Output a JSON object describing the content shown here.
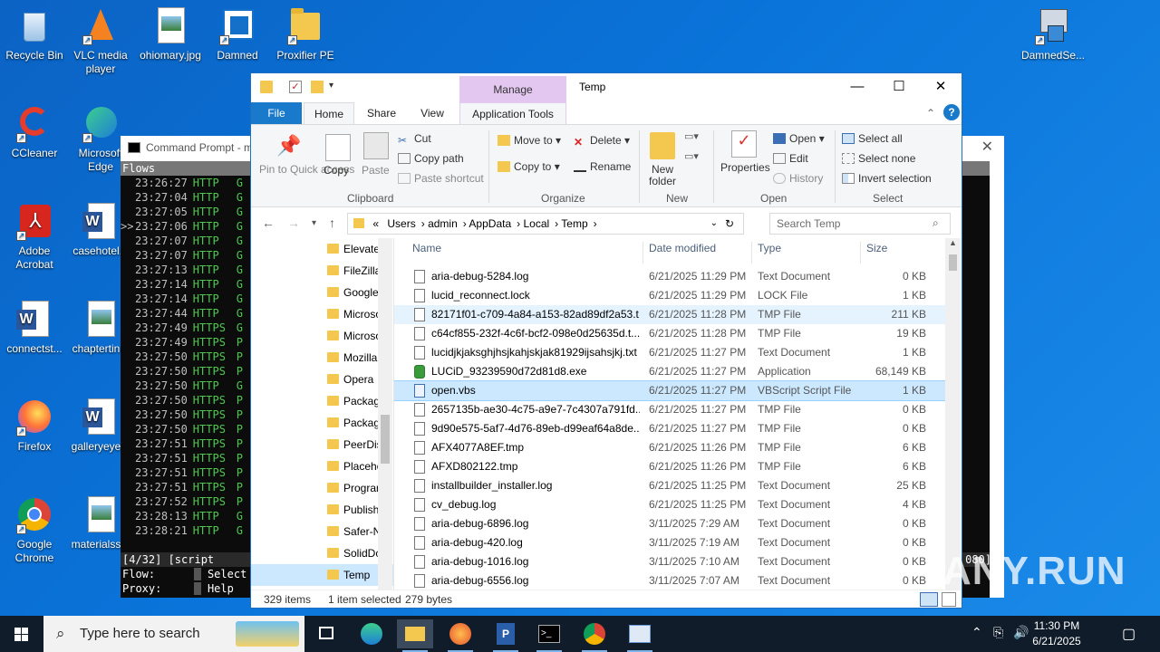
{
  "desktop": {
    "icons": [
      {
        "label": "Recycle Bin",
        "icon": "recycle-bin-icon"
      },
      {
        "label": "VLC media player",
        "icon": "vlc-icon"
      },
      {
        "label": "ohiomary.jpg",
        "icon": "image-file-icon"
      },
      {
        "label": "Damned",
        "icon": "damned-shortcut-icon"
      },
      {
        "label": "Proxifier PE",
        "icon": "folder-icon"
      },
      {
        "label": "CCleaner",
        "icon": "ccleaner-icon"
      },
      {
        "label": "Microsoft Edge",
        "icon": "edge-icon"
      },
      {
        "label": "Adobe Acrobat",
        "icon": "acrobat-icon"
      },
      {
        "label": "casehotel...",
        "icon": "word-doc-icon"
      },
      {
        "label": "connectst...",
        "icon": "word-doc-icon"
      },
      {
        "label": "chaptertin...",
        "icon": "image-file-icon"
      },
      {
        "label": "Firefox",
        "icon": "firefox-icon"
      },
      {
        "label": "galleryeye...",
        "icon": "word-doc-icon"
      },
      {
        "label": "Google Chrome",
        "icon": "chrome-icon"
      },
      {
        "label": "materialss...",
        "icon": "image-file-icon"
      },
      {
        "label": "DamnedSe...",
        "icon": "installer-icon"
      }
    ]
  },
  "cmd": {
    "title": "Command Prompt - m",
    "header": "Flows",
    "rows": [
      {
        "time": "23:26:27",
        "proto": "HTTP",
        "tail": "G"
      },
      {
        "time": "23:27:04",
        "proto": "HTTP",
        "tail": "G"
      },
      {
        "time": "23:27:05",
        "proto": "HTTP",
        "tail": "G"
      },
      {
        "time": "23:27:06",
        "proto": "HTTP",
        "tail": "G",
        "marker": ">>"
      },
      {
        "time": "23:27:07",
        "proto": "HTTP",
        "tail": "G"
      },
      {
        "time": "23:27:07",
        "proto": "HTTP",
        "tail": "G"
      },
      {
        "time": "23:27:13",
        "proto": "HTTP",
        "tail": "G"
      },
      {
        "time": "23:27:14",
        "proto": "HTTP",
        "tail": "G"
      },
      {
        "time": "23:27:14",
        "proto": "HTTP",
        "tail": "G"
      },
      {
        "time": "23:27:44",
        "proto": "HTTP",
        "tail": "G"
      },
      {
        "time": "23:27:49",
        "proto": "HTTPS",
        "tail": "G"
      },
      {
        "time": "23:27:49",
        "proto": "HTTPS",
        "tail": "P"
      },
      {
        "time": "23:27:50",
        "proto": "HTTPS",
        "tail": "P"
      },
      {
        "time": "23:27:50",
        "proto": "HTTPS",
        "tail": "P"
      },
      {
        "time": "23:27:50",
        "proto": "HTTP",
        "tail": "G"
      },
      {
        "time": "23:27:50",
        "proto": "HTTPS",
        "tail": "P"
      },
      {
        "time": "23:27:50",
        "proto": "HTTPS",
        "tail": "P"
      },
      {
        "time": "23:27:50",
        "proto": "HTTPS",
        "tail": "P"
      },
      {
        "time": "23:27:51",
        "proto": "HTTPS",
        "tail": "P"
      },
      {
        "time": "23:27:51",
        "proto": "HTTPS",
        "tail": "P"
      },
      {
        "time": "23:27:51",
        "proto": "HTTPS",
        "tail": "P"
      },
      {
        "time": "23:27:51",
        "proto": "HTTPS",
        "tail": "P"
      },
      {
        "time": "23:27:52",
        "proto": "HTTPS",
        "tail": "P"
      },
      {
        "time": "23:28:13",
        "proto": "HTTP",
        "tail": "G"
      },
      {
        "time": "23:28:21",
        "proto": "HTTP",
        "tail": "G"
      }
    ],
    "status_bar": "[4/32]  [script",
    "status_right": "080]",
    "footer": [
      {
        "key": "Flow:",
        "action": "Select"
      },
      {
        "key": "Proxy:",
        "action": "Help"
      }
    ]
  },
  "explorer": {
    "title": "Temp",
    "manage_tab": "Manage",
    "tabs": {
      "file": "File",
      "home": "Home",
      "share": "Share",
      "view": "View",
      "app_tools": "Application Tools"
    },
    "ribbon": {
      "pin": "Pin to Quick access",
      "copy": "Copy",
      "paste": "Paste",
      "cut": "Cut",
      "copy_path": "Copy path",
      "paste_shortcut": "Paste shortcut",
      "clipboard": "Clipboard",
      "move_to": "Move to",
      "copy_to": "Copy to",
      "delete": "Delete",
      "rename": "Rename",
      "organize": "Organize",
      "new_folder": "New folder",
      "new": "New",
      "properties": "Properties",
      "open_btn": "Open",
      "edit": "Edit",
      "history": "History",
      "open_group": "Open",
      "select_all": "Select all",
      "select_none": "Select none",
      "invert_selection": "Invert selection",
      "select_group": "Select"
    },
    "address": {
      "path": [
        "«",
        "Users",
        "admin",
        "AppData",
        "Local",
        "Temp"
      ],
      "search_placeholder": "Search Temp"
    },
    "nav_items": [
      {
        "label": "Elevate",
        "selected": false
      },
      {
        "label": "FileZilla",
        "selected": false
      },
      {
        "label": "Google",
        "selected": false
      },
      {
        "label": "Microso",
        "selected": false
      },
      {
        "label": "Microso",
        "selected": false
      },
      {
        "label": "Mozilla",
        "selected": false
      },
      {
        "label": "Opera",
        "selected": false
      },
      {
        "label": "Packag",
        "selected": false
      },
      {
        "label": "Packag",
        "selected": false
      },
      {
        "label": "PeerDis",
        "selected": false
      },
      {
        "label": "Placeho",
        "selected": false
      },
      {
        "label": "Progran",
        "selected": false
      },
      {
        "label": "Publish",
        "selected": false
      },
      {
        "label": "Safer-N",
        "selected": false
      },
      {
        "label": "SolidDc",
        "selected": false
      },
      {
        "label": "Temp",
        "selected": true
      }
    ],
    "columns": {
      "name": "Name",
      "date": "Date modified",
      "type": "Type",
      "size": "Size"
    },
    "files": [
      {
        "name": "aria-debug-5284.log",
        "date": "6/21/2025 11:29 PM",
        "type": "Text Document",
        "size": "0 KB",
        "kind": "doc",
        "state": ""
      },
      {
        "name": "lucid_reconnect.lock",
        "date": "6/21/2025 11:29 PM",
        "type": "LOCK File",
        "size": "1 KB",
        "kind": "doc",
        "state": ""
      },
      {
        "name": "82171f01-c709-4a84-a153-82ad89df2a53.t...",
        "date": "6/21/2025 11:28 PM",
        "type": "TMP File",
        "size": "211 KB",
        "kind": "doc",
        "state": "hov"
      },
      {
        "name": "c64cf855-232f-4c6f-bcf2-098e0d25635d.t...",
        "date": "6/21/2025 11:28 PM",
        "type": "TMP File",
        "size": "19 KB",
        "kind": "doc",
        "state": ""
      },
      {
        "name": "lucidjkjaksghjhsjkahjskjak81929ijsahsjkj.txt",
        "date": "6/21/2025 11:27 PM",
        "type": "Text Document",
        "size": "1 KB",
        "kind": "doc",
        "state": ""
      },
      {
        "name": "LUCiD_93239590d72d81d8.exe",
        "date": "6/21/2025 11:27 PM",
        "type": "Application",
        "size": "68,149 KB",
        "kind": "app",
        "state": ""
      },
      {
        "name": "open.vbs",
        "date": "6/21/2025 11:27 PM",
        "type": "VBScript Script File",
        "size": "1 KB",
        "kind": "vbs",
        "state": "sel"
      },
      {
        "name": "2657135b-ae30-4c75-a9e7-7c4307a791fd....",
        "date": "6/21/2025 11:27 PM",
        "type": "TMP File",
        "size": "0 KB",
        "kind": "doc",
        "state": ""
      },
      {
        "name": "9d90e575-5af7-4d76-89eb-d99eaf64a8de....",
        "date": "6/21/2025 11:27 PM",
        "type": "TMP File",
        "size": "0 KB",
        "kind": "doc",
        "state": ""
      },
      {
        "name": "AFX4077A8EF.tmp",
        "date": "6/21/2025 11:26 PM",
        "type": "TMP File",
        "size": "6 KB",
        "kind": "doc",
        "state": ""
      },
      {
        "name": "AFXD802122.tmp",
        "date": "6/21/2025 11:26 PM",
        "type": "TMP File",
        "size": "6 KB",
        "kind": "doc",
        "state": ""
      },
      {
        "name": "installbuilder_installer.log",
        "date": "6/21/2025 11:25 PM",
        "type": "Text Document",
        "size": "25 KB",
        "kind": "doc",
        "state": ""
      },
      {
        "name": "cv_debug.log",
        "date": "6/21/2025 11:25 PM",
        "type": "Text Document",
        "size": "4 KB",
        "kind": "doc",
        "state": ""
      },
      {
        "name": "aria-debug-6896.log",
        "date": "3/11/2025 7:29 AM",
        "type": "Text Document",
        "size": "0 KB",
        "kind": "doc",
        "state": ""
      },
      {
        "name": "aria-debug-420.log",
        "date": "3/11/2025 7:19 AM",
        "type": "Text Document",
        "size": "0 KB",
        "kind": "doc",
        "state": ""
      },
      {
        "name": "aria-debug-1016.log",
        "date": "3/11/2025 7:10 AM",
        "type": "Text Document",
        "size": "0 KB",
        "kind": "doc",
        "state": ""
      },
      {
        "name": "aria-debug-6556.log",
        "date": "3/11/2025 7:07 AM",
        "type": "Text Document",
        "size": "0 KB",
        "kind": "doc",
        "state": ""
      }
    ],
    "status": {
      "count": "329 items",
      "selected": "1 item selected",
      "bytes": "279 bytes"
    }
  },
  "taskbar": {
    "search_placeholder": "Type here to search",
    "time": "11:30 PM",
    "date": "6/21/2025"
  },
  "watermark": "ANY.RUN"
}
